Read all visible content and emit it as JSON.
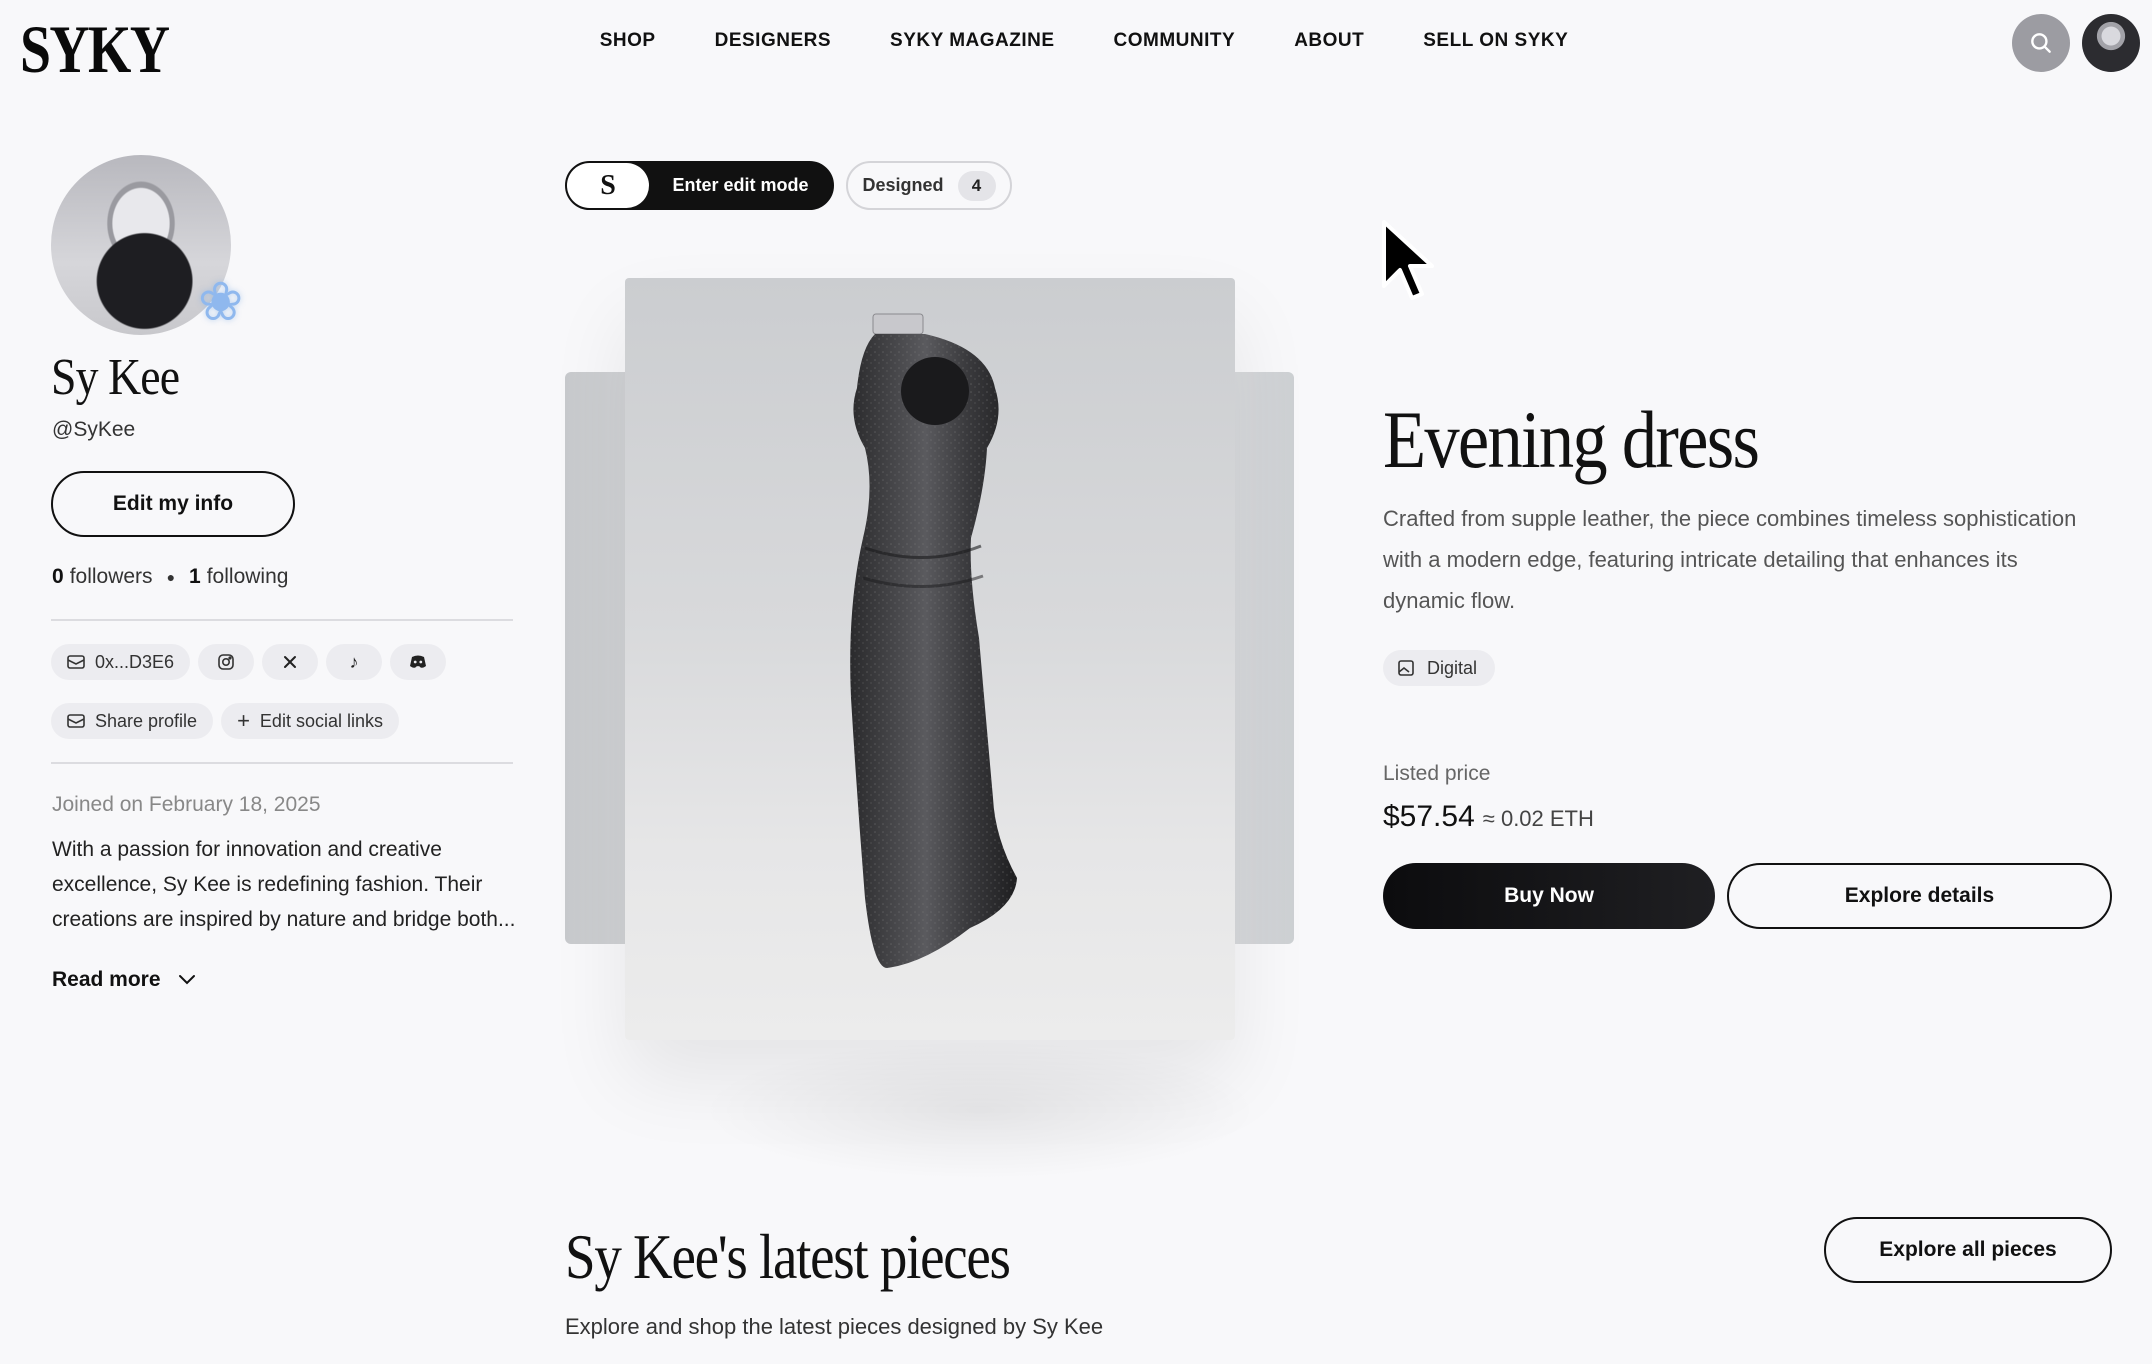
{
  "header": {
    "logo": "SYKY",
    "nav": [
      "SHOP",
      "DESIGNERS",
      "SYKY MAGAZINE",
      "COMMUNITY",
      "ABOUT",
      "SELL ON SYKY"
    ]
  },
  "profile": {
    "name": "Sy Kee",
    "handle": "@SyKee",
    "edit_button": "Edit my info",
    "followers_count": "0",
    "followers_label": "followers",
    "following_count": "1",
    "following_label": "following",
    "wallet": "0x...D3E6",
    "socials": [
      "instagram-icon",
      "x-icon",
      "tiktok-icon",
      "discord-icon"
    ],
    "share_label": "Share profile",
    "edit_social_label": "Edit social links",
    "joined": "Joined on February 18, 2025",
    "bio": "With a passion for innovation and creative excellence, Sy Kee is redefining fashion. Their creations are inspired by nature and bridge both...",
    "read_more": "Read more"
  },
  "toolbar": {
    "toggle_glyph": "S",
    "edit_mode_label": "Enter edit mode",
    "designed_label": "Designed",
    "designed_count": "4"
  },
  "product": {
    "title": "Evening dress",
    "description": "Crafted from supple leather, the piece combines timeless sophistication with a modern edge, featuring intricate detailing that enhances its dynamic flow.",
    "type_chip": "Digital",
    "price_label": "Listed price",
    "price_usd": "$57.54",
    "price_eth": "≈ 0.02 ETH",
    "buy_label": "Buy Now",
    "details_label": "Explore details"
  },
  "latest": {
    "title": "Sy Kee's latest pieces",
    "subtitle": "Explore and shop the latest pieces designed by Sy Kee",
    "explore_all": "Explore all pieces"
  },
  "colors": {
    "background": "#f8f8fa",
    "primary": "#111111",
    "chip": "#ececf0",
    "muted_text": "#888888"
  }
}
